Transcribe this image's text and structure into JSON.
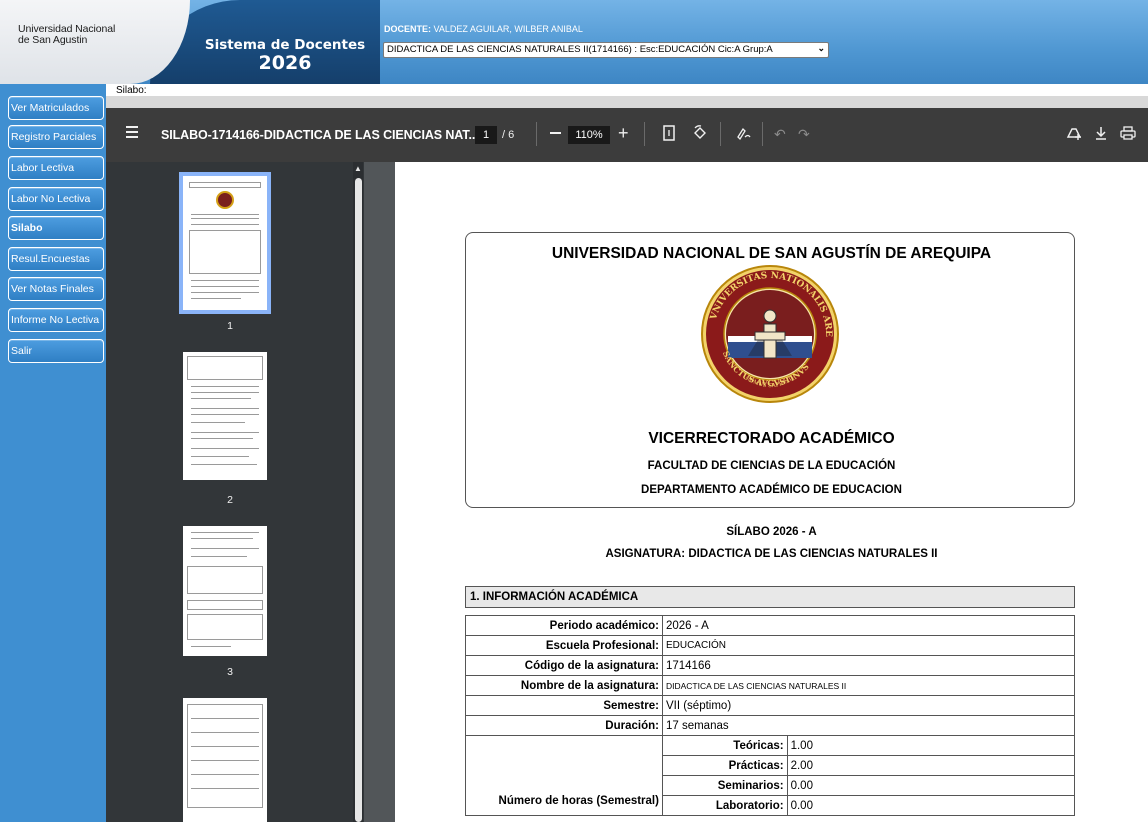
{
  "header": {
    "university_line1": "Universidad Nacional",
    "university_line2": "de San Agustin",
    "system_title": "Sistema de Docentes",
    "year": "2026",
    "docente_label": "DOCENTE:",
    "docente_name": "VALDEZ AGUILAR, WILBER ANIBAL",
    "course_selected": "DIDACTICA DE LAS CIENCIAS NATURALES II(1714166) : Esc:EDUCACIÓN Cic:A Grup:A"
  },
  "sidebar": {
    "items": [
      {
        "label": "Ver Matriculados"
      },
      {
        "label": "Registro Parciales"
      },
      {
        "label": "Labor Lectiva"
      },
      {
        "label": "Labor No Lectiva"
      },
      {
        "label": "Silabo"
      },
      {
        "label": "Resul.Encuestas"
      },
      {
        "label": "Ver Notas Finales"
      },
      {
        "label": "Informe No Lectiva"
      },
      {
        "label": "Salir"
      }
    ]
  },
  "content": {
    "label": "Silabo:"
  },
  "viewer": {
    "doc_title": "SILABO-1714166-DIDACTICA DE LAS CIENCIAS NAT...",
    "current_page": "1",
    "page_total": "/ 6",
    "zoom": "110%",
    "thumbnails": [
      "1",
      "2",
      "3"
    ]
  },
  "document": {
    "university": "UNIVERSIDAD NACIONAL DE SAN AGUSTÍN DE AREQUIPA",
    "seal_text_top": "VNIVERSITAS NATIONALIS AREQUIPENSIS",
    "seal_text_left": "SANCTUS AVGVSTINVS",
    "seal_motto": "DOMUS SAPIENTIAE",
    "vicerrectorado": "VICERRECTORADO ACADÉMICO",
    "facultad": "FACULTAD DE CIENCIAS DE LA EDUCACIÓN",
    "departamento": "DEPARTAMENTO ACADÉMICO DE EDUCACION",
    "silabo_title": "SÍLABO 2026 - A",
    "asignatura_title": "ASIGNATURA: DIDACTICA DE LAS CIENCIAS NATURALES II",
    "section1": "1. INFORMACIÓN ACADÉMICA",
    "rows": [
      {
        "label": "Periodo académico:",
        "value": "2026 - A"
      },
      {
        "label": "Escuela Profesional:",
        "value": "EDUCACIÓN"
      },
      {
        "label": "Código de la asignatura:",
        "value": "1714166"
      },
      {
        "label": "Nombre de la asignatura:",
        "value": "DIDACTICA DE LAS CIENCIAS NATURALES II"
      },
      {
        "label": "Semestre:",
        "value": "VII (séptimo)"
      },
      {
        "label": "Duración:",
        "value": "17 semanas"
      }
    ],
    "horas_label": "Número de horas (Semestral)",
    "horas": [
      {
        "label": "Teóricas:",
        "value": "1.00"
      },
      {
        "label": "Prácticas:",
        "value": "2.00"
      },
      {
        "label": "Seminarios:",
        "value": "0.00"
      },
      {
        "label": "Laboratorio:",
        "value": "0.00"
      }
    ]
  },
  "colors": {
    "header_blue": "#4f97d2",
    "nav_blue": "#3f8fd1",
    "viewer_toolbar": "#3c3c3c",
    "viewer_bg": "#525659",
    "thumb_selected": "#8ab4f8"
  }
}
